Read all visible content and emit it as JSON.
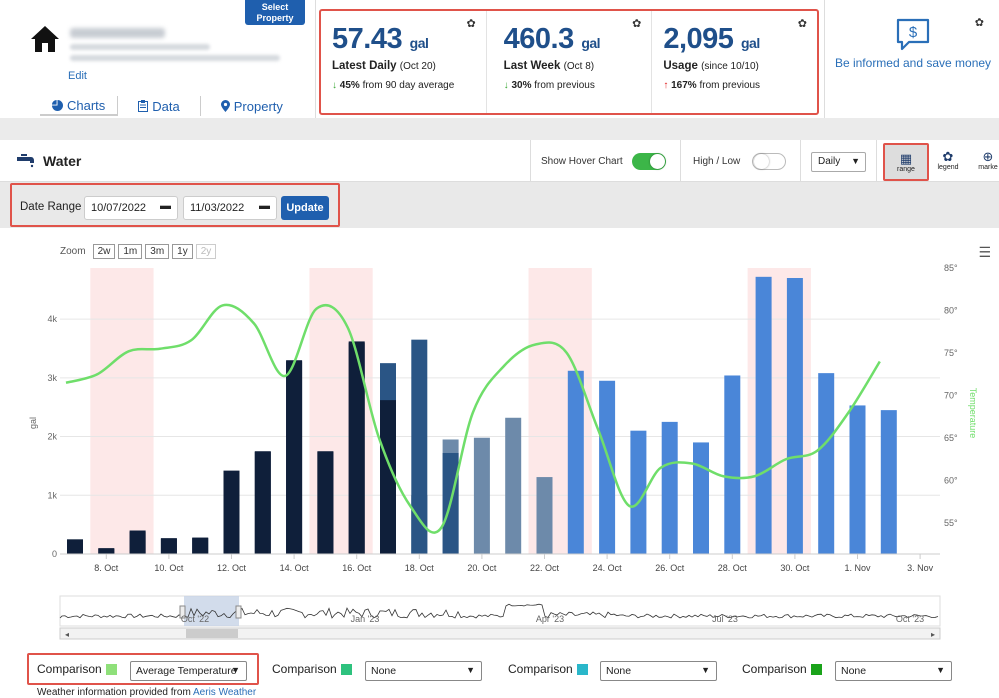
{
  "property": {
    "edit_label": "Edit",
    "select_label": "Select Property",
    "tabs": [
      {
        "label": "Charts",
        "icon": "pie-chart-icon"
      },
      {
        "label": "Data",
        "icon": "clipboard-icon"
      },
      {
        "label": "Property",
        "icon": "map-pin-icon"
      }
    ]
  },
  "stats": [
    {
      "value": "57.43",
      "unit": "gal",
      "label": "Latest Daily",
      "sub": "(Oct 20)",
      "change": "45%",
      "change_text": "from 90 day average",
      "direction": "down"
    },
    {
      "value": "460.3",
      "unit": "gal",
      "label": "Last Week",
      "sub": "(Oct 8)",
      "change": "30%",
      "change_text": "from previous",
      "direction": "down"
    },
    {
      "value": "2,095",
      "unit": "gal",
      "label": "Usage",
      "sub": "(since 10/10)",
      "change": "167%",
      "change_text": "from previous",
      "direction": "up"
    }
  ],
  "info": {
    "text": "Be informed and save money"
  },
  "toolbar": {
    "title": "Water",
    "hover_label": "Show Hover Chart",
    "hover_on": true,
    "highlow_label": "High / Low",
    "highlow_on": false,
    "interval": "Daily",
    "range_label": "range",
    "legend_label": "legend",
    "markers_label": "marke"
  },
  "date_range": {
    "label": "Date Range",
    "start": "10/07/2022",
    "end": "11/03/2022",
    "update_label": "Update"
  },
  "zoom": {
    "label": "Zoom",
    "options": [
      "2w",
      "1m",
      "3m",
      "1y",
      "2y"
    ],
    "disabled": "2y"
  },
  "chart_data": {
    "type": "bar",
    "categories": [
      "Oct 7",
      "Oct 8",
      "Oct 9",
      "Oct 10",
      "Oct 11",
      "Oct 12",
      "Oct 13",
      "Oct 14",
      "Oct 15",
      "Oct 16",
      "Oct 17",
      "Oct 18",
      "Oct 19",
      "Oct 20",
      "Oct 21",
      "Oct 22",
      "Oct 23",
      "Oct 24",
      "Oct 25",
      "Oct 26",
      "Oct 27",
      "Oct 28",
      "Oct 29",
      "Oct 30",
      "Oct 31",
      "Nov 1",
      "Nov 2"
    ],
    "series": [
      {
        "values": [
          250,
          100,
          400,
          270,
          280,
          1420,
          1750,
          3300,
          1750,
          3620,
          3250,
          3650,
          1950,
          1980,
          2320,
          1310,
          3120,
          2950,
          2100,
          2250,
          1900,
          3040,
          4720,
          4700,
          3080,
          2530,
          2450
        ]
      },
      {
        "values": [
          240,
          90,
          380,
          260,
          270,
          1400,
          1740,
          3280,
          1740,
          3600,
          2620,
          1000,
          1720,
          0,
          0,
          0,
          0,
          0,
          0,
          0,
          0,
          0,
          0,
          0,
          0,
          0,
          0
        ]
      },
      {
        "name": "Temperature",
        "values": [
          71.5,
          72.5,
          75.2,
          75.5,
          76.5,
          80.6,
          78.5,
          72.3,
          80.2,
          78.0,
          65.0,
          57.0,
          54.5,
          68.0,
          73.5,
          76.0,
          75.0,
          66.0,
          57.0,
          61.5,
          62.0,
          60.5,
          60.5,
          62.5,
          63.5,
          68.0,
          74.0
        ]
      }
    ],
    "xticks": [
      "8. Oct",
      "10. Oct",
      "12. Oct",
      "14. Oct",
      "16. Oct",
      "18. Oct",
      "20. Oct",
      "22. Oct",
      "24. Oct",
      "26. Oct",
      "28. Oct",
      "30. Oct",
      "1. Nov",
      "3. Nov"
    ],
    "yticks_left": [
      "0",
      "1k",
      "2k",
      "3k",
      "4k"
    ],
    "yticks_right": [
      "55°",
      "60°",
      "65°",
      "70°",
      "75°",
      "80°",
      "85°"
    ],
    "ylabel": "gal",
    "y2label": "Temperature",
    "ylim": [
      0,
      4700
    ],
    "y2lim": [
      53,
      85
    ],
    "weekend_bands": [
      [
        "Oct 8",
        "Oct 9"
      ],
      [
        "Oct 15",
        "Oct 16"
      ],
      [
        "Oct 22",
        "Oct 23"
      ],
      [
        "Oct 29",
        "Oct 30"
      ]
    ],
    "navigator_labels": [
      "Oct '22",
      "Jan '23",
      "Apr '23",
      "Jul '23",
      "Oct '23"
    ],
    "colors": {
      "bar_main": "#4a86d8",
      "bar_dark": "#0f1f3a",
      "bar_gray": "#6d8aaa",
      "temperature": "#6fde6a",
      "weekend": "#fde8e8"
    }
  },
  "comparisons": [
    {
      "label": "Comparison",
      "color": "#8fe07a",
      "value": "Average Temperature"
    },
    {
      "label": "Comparison",
      "color": "#2ec27e",
      "value": "None"
    },
    {
      "label": "Comparison",
      "color": "#2ab7ca",
      "value": "None"
    },
    {
      "label": "Comparison",
      "color": "#1aa31a",
      "value": "None"
    }
  ],
  "weather_credit": {
    "text": "Weather information provided from",
    "link": "Aeris Weather"
  }
}
